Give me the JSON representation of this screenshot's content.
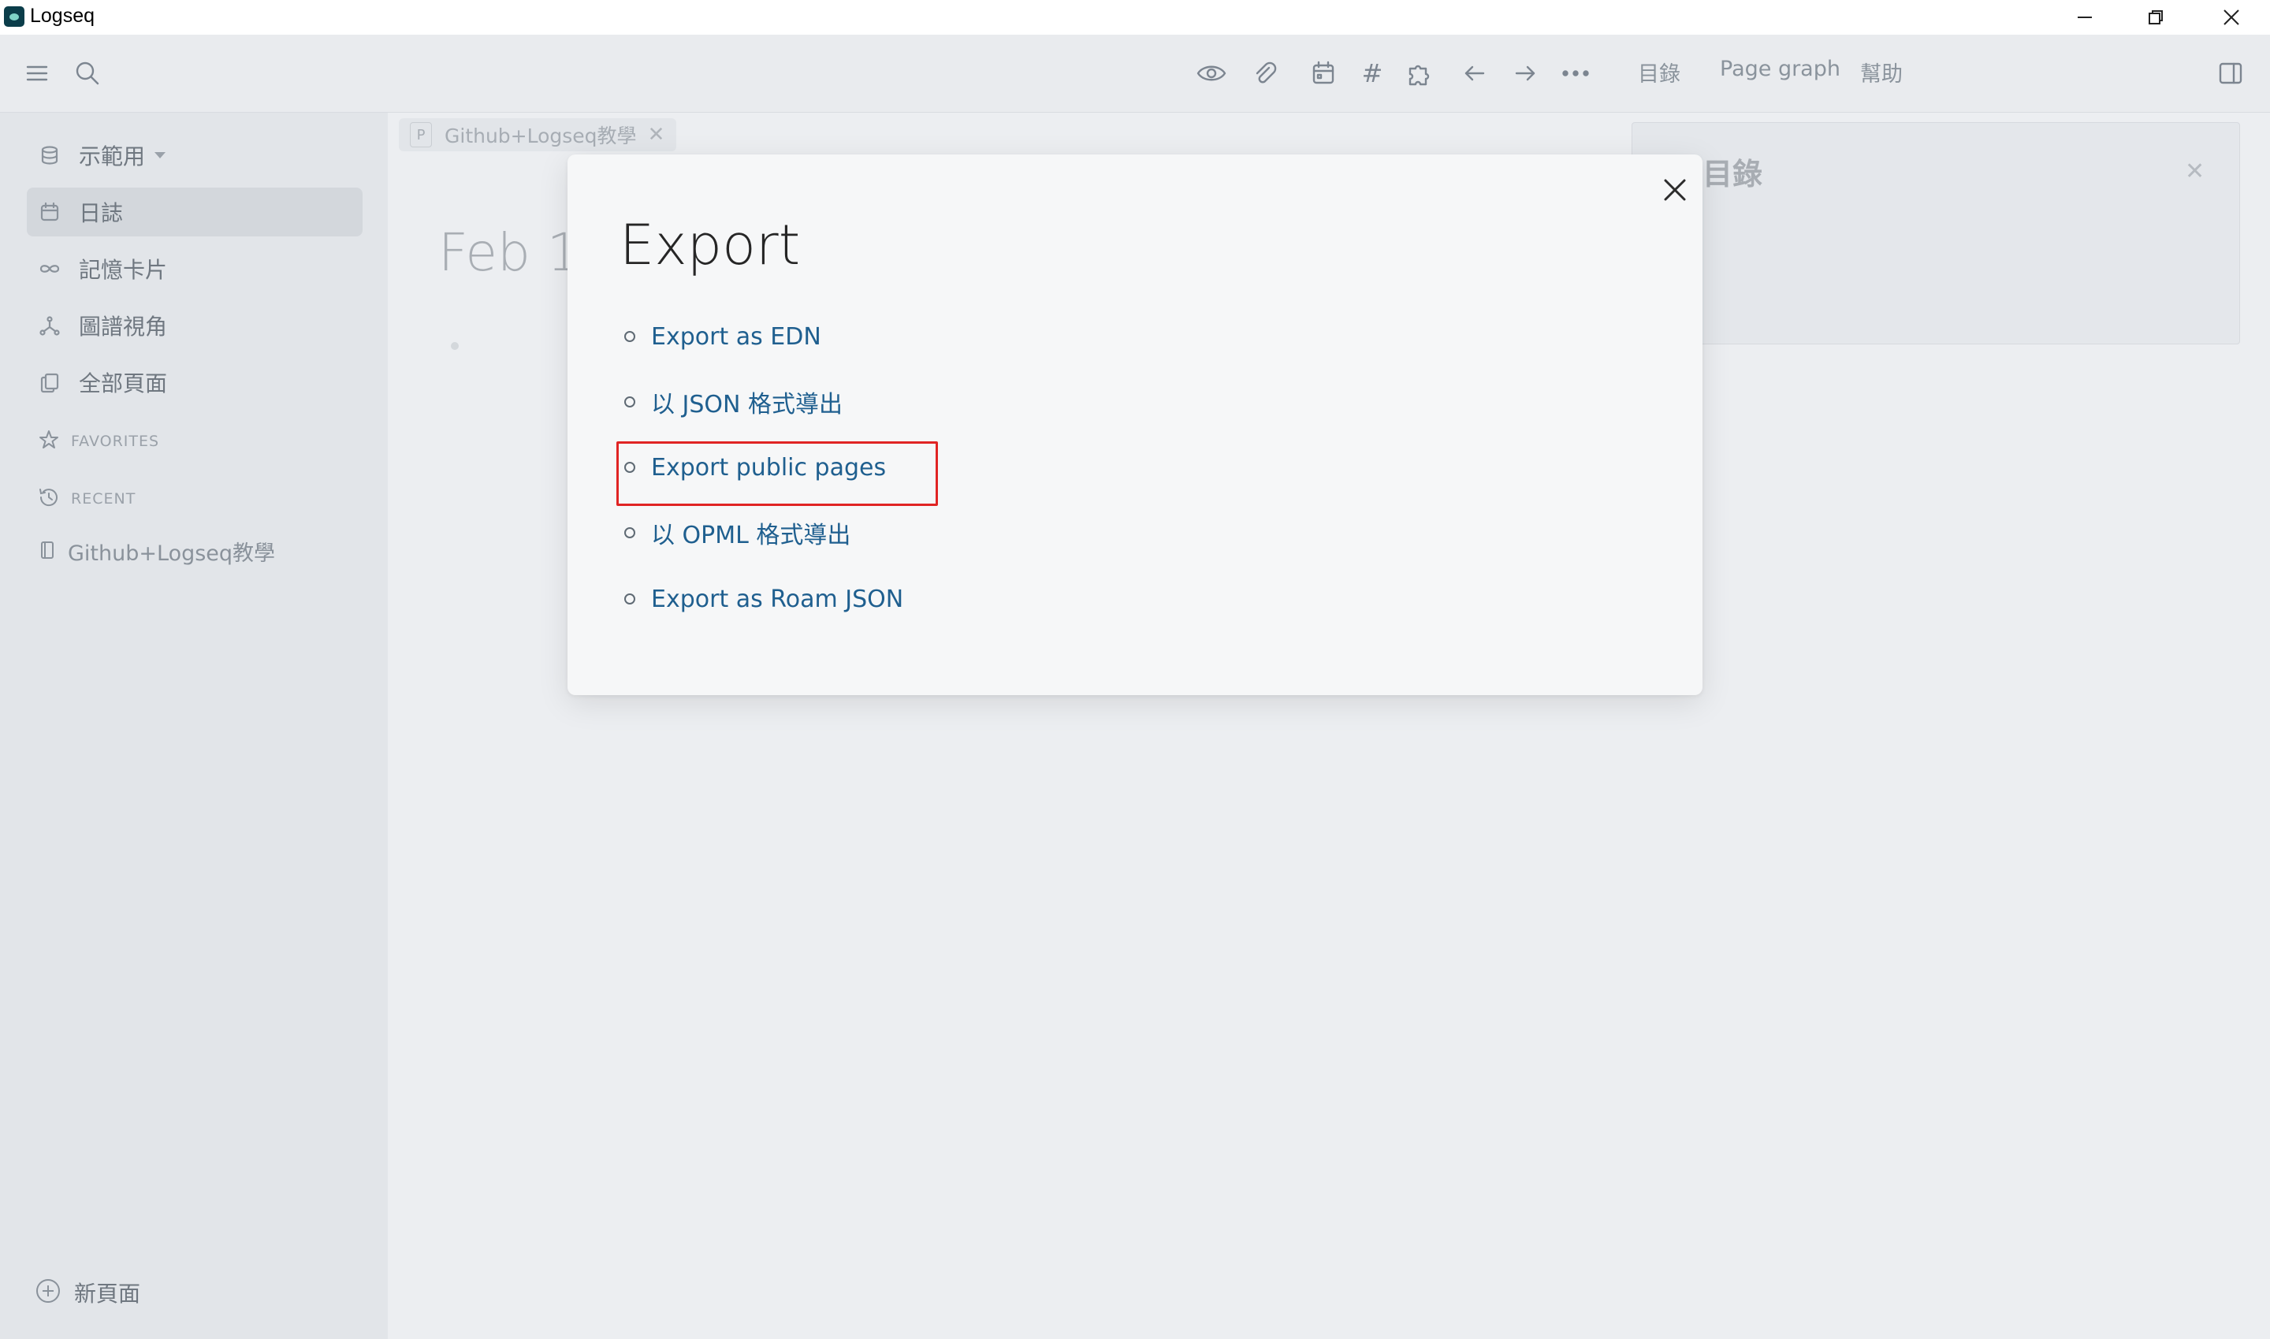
{
  "window": {
    "title": "Logseq"
  },
  "header": {
    "toc_label": "目錄",
    "page_graph_label": "Page graph",
    "help_label": "幫助",
    "tag_glyph": "#"
  },
  "sidebar": {
    "graph_name": "示範用",
    "items": [
      {
        "label": "日誌",
        "icon": "calendar-icon",
        "active": true
      },
      {
        "label": "記憶卡片",
        "icon": "infinity-icon",
        "active": false
      },
      {
        "label": "圖譜視角",
        "icon": "graph-icon",
        "active": false
      },
      {
        "label": "全部頁面",
        "icon": "pages-icon",
        "active": false
      }
    ],
    "favorites_label": "FAVORITES",
    "recent_label": "RECENT",
    "recent_items": [
      {
        "label": "Github+Logseq教學"
      }
    ],
    "new_page_label": "新頁面"
  },
  "main": {
    "tab": {
      "badge": "P",
      "label": "Github+Logseq教學",
      "close": "✕"
    },
    "journal_date": "Feb 1",
    "toc_panel_title": "目錄",
    "toc_close": "✕"
  },
  "modal": {
    "title": "Export",
    "options": [
      {
        "label": "Export as EDN"
      },
      {
        "label": "以 JSON 格式導出"
      },
      {
        "label": "Export public pages",
        "highlighted": true
      },
      {
        "label": "以 OPML 格式導出"
      },
      {
        "label": "Export as Roam JSON"
      }
    ]
  },
  "colors": {
    "link": "#1f5f8f",
    "highlight_border": "#e02424",
    "sidebar_bg": "#e2e5e9",
    "header_bg": "#e9ebee"
  }
}
